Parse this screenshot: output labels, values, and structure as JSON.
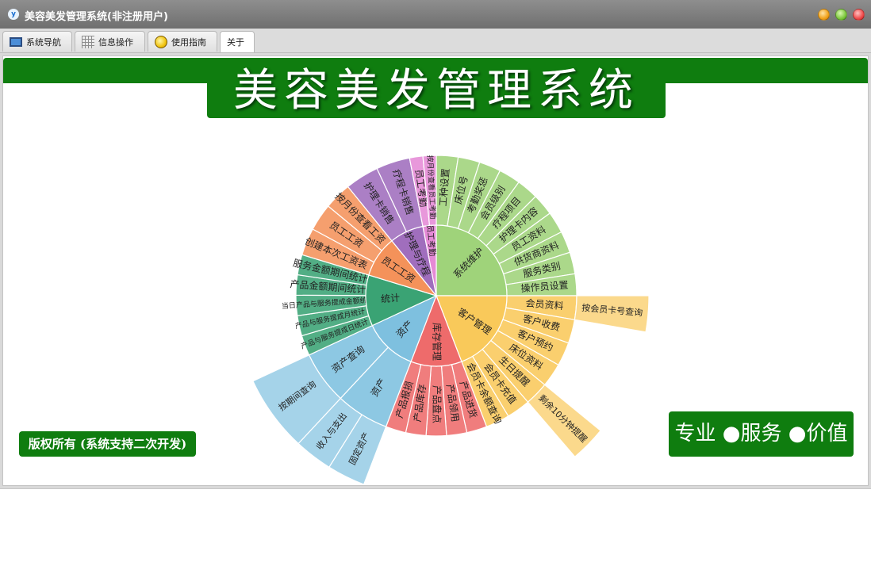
{
  "window": {
    "title": "美容美发管理系统(非注册用户)",
    "icon": "app-logo-icon"
  },
  "tabs": [
    {
      "label": "系统导航",
      "icon": "monitor-icon"
    },
    {
      "label": "信息操作",
      "icon": "grid-icon"
    },
    {
      "label": "使用指南",
      "icon": "lightbulb-icon"
    },
    {
      "label": "关于",
      "icon": "",
      "active": true
    }
  ],
  "banner": {
    "title": "美容美发管理系统"
  },
  "footer": {
    "copyright": "版权所有 (系统支持二次开发)",
    "slogan": "专业 ●服务 ●价值"
  },
  "colors": {
    "brand_green": "#0f7d0f",
    "系统维护": "#9fd37a",
    "客户管理": "#f9c95a",
    "库存管理": "#ee6b6b",
    "资产": "#7ec0df",
    "统计": "#3aa374",
    "员工工资": "#f4925a",
    "护理与疗程": "#a06ebd",
    "员工考勤": "#e58ad6"
  },
  "sunburst": {
    "groups": [
      {
        "name": "系统维护",
        "children": [
          {
            "name": "工种设置"
          },
          {
            "name": "床位号"
          },
          {
            "name": "考勤奖惩"
          },
          {
            "name": "会员级别"
          },
          {
            "name": "疗程项目"
          },
          {
            "name": "护理卡内容"
          },
          {
            "name": "员工资料"
          },
          {
            "name": "供货商资料"
          },
          {
            "name": "服务类别"
          },
          {
            "name": "操作员设置"
          }
        ]
      },
      {
        "name": "客户管理",
        "children": [
          {
            "name": "会员资料",
            "children": [
              {
                "name": "按会员卡号查询"
              }
            ]
          },
          {
            "name": "客户收费"
          },
          {
            "name": "客户预约"
          },
          {
            "name": "床位资料"
          },
          {
            "name": "生日提醒",
            "children": [
              {
                "name": "剩余10分钟提醒"
              }
            ]
          },
          {
            "name": "会员卡充值"
          },
          {
            "name": "会员卡余额查询"
          }
        ]
      },
      {
        "name": "库存管理",
        "children": [
          {
            "name": "产品进货"
          },
          {
            "name": "产品领用"
          },
          {
            "name": "产品盘点"
          },
          {
            "name": "产品库存"
          },
          {
            "name": "产品报损"
          }
        ]
      },
      {
        "name": "资产",
        "children": [
          {
            "name": "资产",
            "children": [
              {
                "name": "固定资产"
              },
              {
                "name": "收入与支出"
              }
            ]
          },
          {
            "name": "资产查询",
            "children": [
              {
                "name": "按期间查询"
              }
            ]
          }
        ]
      },
      {
        "name": "统计",
        "children": [
          {
            "name": "产品与服务提成日统计"
          },
          {
            "name": "产品与服务提成月统计"
          },
          {
            "name": "当日产品与服务提成金额统计"
          },
          {
            "name": "产品金额期间统计"
          },
          {
            "name": "服务金额期间统计"
          }
        ]
      },
      {
        "name": "员工工资",
        "children": [
          {
            "name": "创建本次工资表"
          },
          {
            "name": "员工工资"
          },
          {
            "name": "按月份查看工资"
          }
        ]
      },
      {
        "name": "护理与疗程",
        "children": [
          {
            "name": "护理卡销售"
          },
          {
            "name": "疗程卡销售"
          }
        ]
      },
      {
        "name": "员工考勤",
        "children": [
          {
            "name": "员工考勤"
          },
          {
            "name": "按月份查看员工考勤"
          }
        ]
      }
    ]
  }
}
